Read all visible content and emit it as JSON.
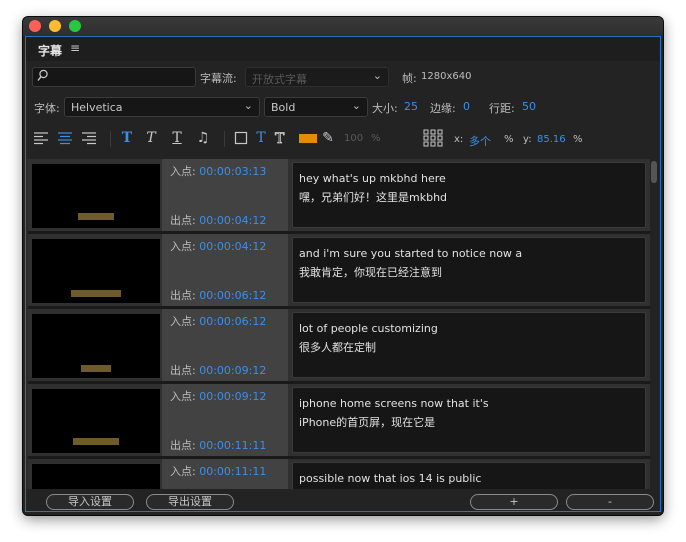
{
  "panel": {
    "title": "字幕",
    "menu_icon": "hamburger-icon"
  },
  "search": {
    "placeholder": "",
    "value": ""
  },
  "stream": {
    "label": "字幕流:",
    "value": "开放式字幕"
  },
  "frame": {
    "label": "帧:",
    "value": "1280x640"
  },
  "font": {
    "label": "字体:",
    "family": "Helvetica",
    "style": "Bold",
    "size_label": "大小:",
    "size": "25",
    "edge_label": "边缘:",
    "edge": "0",
    "line_label": "行距:",
    "line": "50"
  },
  "toolbar": {
    "opacity": "100",
    "opacity_unit": "%",
    "swatch_color": "#e68a00",
    "x_label": "x:",
    "x_value": "多个",
    "x_unit": "%",
    "y_label": "y:",
    "y_value": "85.16",
    "y_unit": "%"
  },
  "captions": [
    {
      "in_label": "入点:",
      "in": "00:00:03:13",
      "out_label": "出点:",
      "out": "00:00:04:12",
      "line1": "hey what's up mkbhd here",
      "line2": "嘿，兄弟们好！这里是mkbhd"
    },
    {
      "in_label": "入点:",
      "in": "00:00:04:12",
      "out_label": "出点:",
      "out": "00:00:06:12",
      "line1": "and i'm sure you started to notice now a",
      "line2": "我敢肯定，你现在已经注意到"
    },
    {
      "in_label": "入点:",
      "in": "00:00:06:12",
      "out_label": "出点:",
      "out": "00:00:09:12",
      "line1": "lot of people customizing",
      "line2": "很多人都在定制"
    },
    {
      "in_label": "入点:",
      "in": "00:00:09:12",
      "out_label": "出点:",
      "out": "00:00:11:11",
      "line1": "iphone home screens now that it's",
      "line2": "iPhone的首页屏，现在它是"
    },
    {
      "in_label": "入点:",
      "in": "00:00:11:11",
      "out_label": "",
      "out": "",
      "line1": "possible now that ios 14 is public",
      "line2": ""
    }
  ],
  "footer": {
    "import": "导入设置",
    "export": "导出设置",
    "add": "+",
    "remove": "-"
  }
}
